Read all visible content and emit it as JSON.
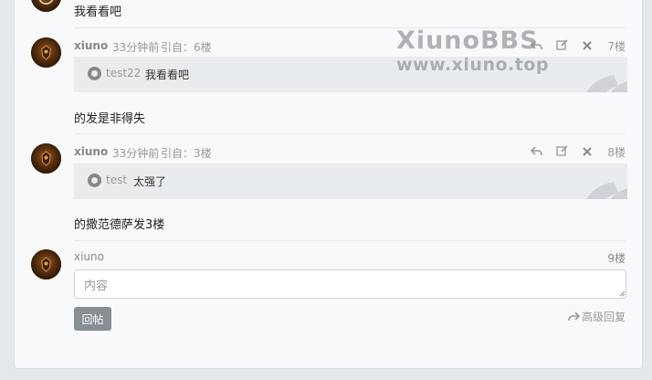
{
  "top_post": {
    "text": "我看看吧"
  },
  "watermark": {
    "line1": "XiunoBBS",
    "line2": "www.xiuno.top"
  },
  "posts": [
    {
      "username": "xiuno",
      "time": "33分钟前",
      "quote_ref": "引自：6楼",
      "floor": "7楼",
      "quote_user": "test22",
      "quote_text": "我看看吧",
      "body": "的发是非得失"
    },
    {
      "username": "xiuno",
      "time": "33分钟前",
      "quote_ref": "引自：3楼",
      "floor": "8楼",
      "quote_user": "test",
      "quote_text": "太强了",
      "body": "的撒范德萨发3楼"
    }
  ],
  "reply": {
    "username": "xiuno",
    "floor": "9楼",
    "placeholder": "内容",
    "submit_label": "回帖",
    "advanced_label": "高级回复"
  },
  "icons": {
    "reply": "reply-arrow-icon",
    "edit": "edit-icon",
    "delete": "close-icon",
    "quote_mark": "quote-mark-icon"
  },
  "colors": {
    "page_bg": "#e5e8eb",
    "card_bg": "#f8f9fa",
    "quote_bg": "#e9ecef",
    "button_bg": "#878e94",
    "muted_text": "#999999"
  }
}
